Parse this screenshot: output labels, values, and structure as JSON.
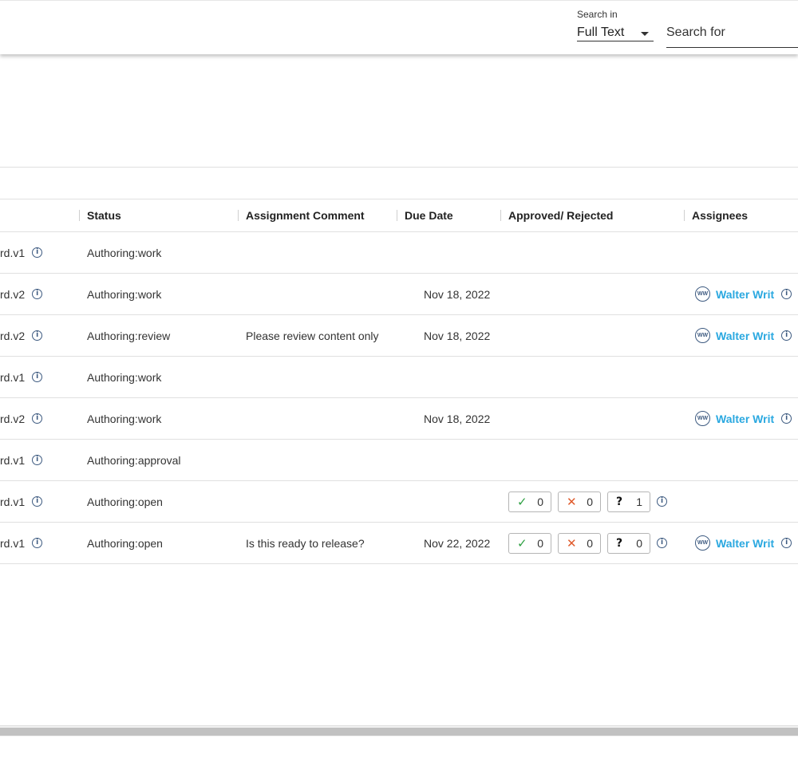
{
  "search": {
    "search_in_label": "Search in",
    "search_in_value": "Full Text",
    "search_for_placeholder": "Search for"
  },
  "table": {
    "columns": [
      "Status",
      "Assignment Comment",
      "Due Date",
      "Approved/ Rejected",
      "Assignees"
    ],
    "rows": [
      {
        "name": "rd.v1",
        "status": "Authoring:work",
        "comment": "",
        "due": "",
        "votes": null,
        "assignee": ""
      },
      {
        "name": "rd.v2",
        "status": "Authoring:work",
        "comment": "",
        "due": "Nov 18, 2022",
        "votes": null,
        "assignee": "Walter Writ"
      },
      {
        "name": "rd.v2",
        "status": "Authoring:review",
        "comment": "Please review content only",
        "due": "Nov 18, 2022",
        "votes": null,
        "assignee": "Walter Writ"
      },
      {
        "name": "rd.v1",
        "status": "Authoring:work",
        "comment": "",
        "due": "",
        "votes": null,
        "assignee": ""
      },
      {
        "name": "rd.v2",
        "status": "Authoring:work",
        "comment": "",
        "due": "Nov 18, 2022",
        "votes": null,
        "assignee": "Walter Writ"
      },
      {
        "name": "rd.v1",
        "status": "Authoring:approval",
        "comment": "",
        "due": "",
        "votes": null,
        "assignee": ""
      },
      {
        "name": "rd.v1",
        "status": "Authoring:open",
        "comment": "",
        "due": "",
        "votes": {
          "approved": "0",
          "rejected": "0",
          "pending": "1"
        },
        "assignee": ""
      },
      {
        "name": "rd.v1",
        "status": "Authoring:open",
        "comment": "Is this ready to release?",
        "due": "Nov 22, 2022",
        "votes": {
          "approved": "0",
          "rejected": "0",
          "pending": "0"
        },
        "assignee": "Walter Writ"
      }
    ],
    "avatar_initials": "WW"
  },
  "icons": {
    "info": "info-circle-icon",
    "approve": "check-icon",
    "reject": "x-icon",
    "pending": "question-icon",
    "dropdown": "caret-down-icon"
  },
  "colors": {
    "assignee_link": "#2aa8e0",
    "approve": "#2ea043",
    "reject": "#e05a2b",
    "icon": "#3d5a80"
  }
}
